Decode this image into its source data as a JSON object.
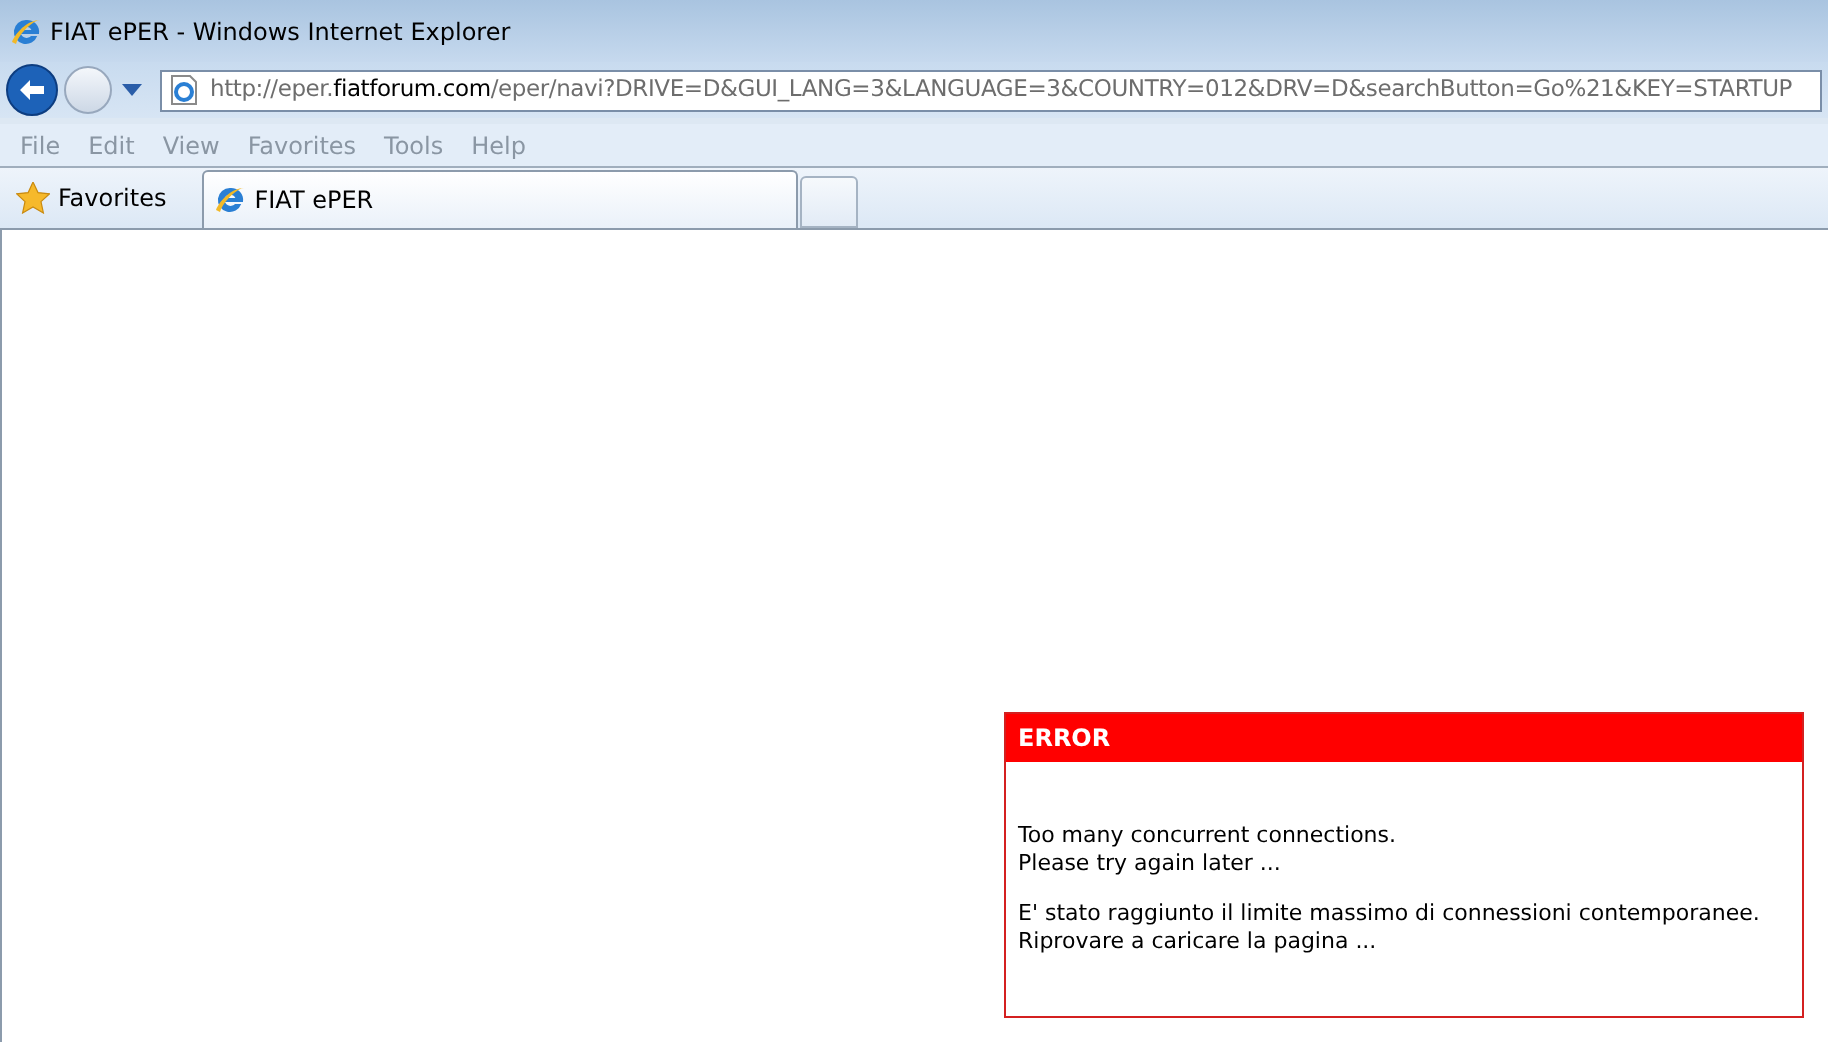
{
  "window": {
    "title": "FIAT ePER - Windows Internet Explorer"
  },
  "address_bar": {
    "url": "http://eper.**fiatforum.com**/eper/navi?DRIVE=D&GUI_LANG=3&LANGUAGE=3&COUNTRY=012&DRV=D&searchButton=Go%21&KEY=STARTUP"
  },
  "menu": [
    "File",
    "Edit",
    "View",
    "Favorites",
    "Tools",
    "Help"
  ],
  "favorites_button": {
    "label": "Favorites"
  },
  "tabs": [
    {
      "label": "FIAT ePER",
      "selected": true
    }
  ],
  "error_box": {
    "title": "ERROR",
    "paragraphs": [
      [
        "Too many concurrent connections.",
        "Please try again later ..."
      ],
      [
        "E' stato raggiunto il limite massimo di connessioni contemporanee.",
        "Riprovare a caricare la pagina ..."
      ]
    ]
  }
}
